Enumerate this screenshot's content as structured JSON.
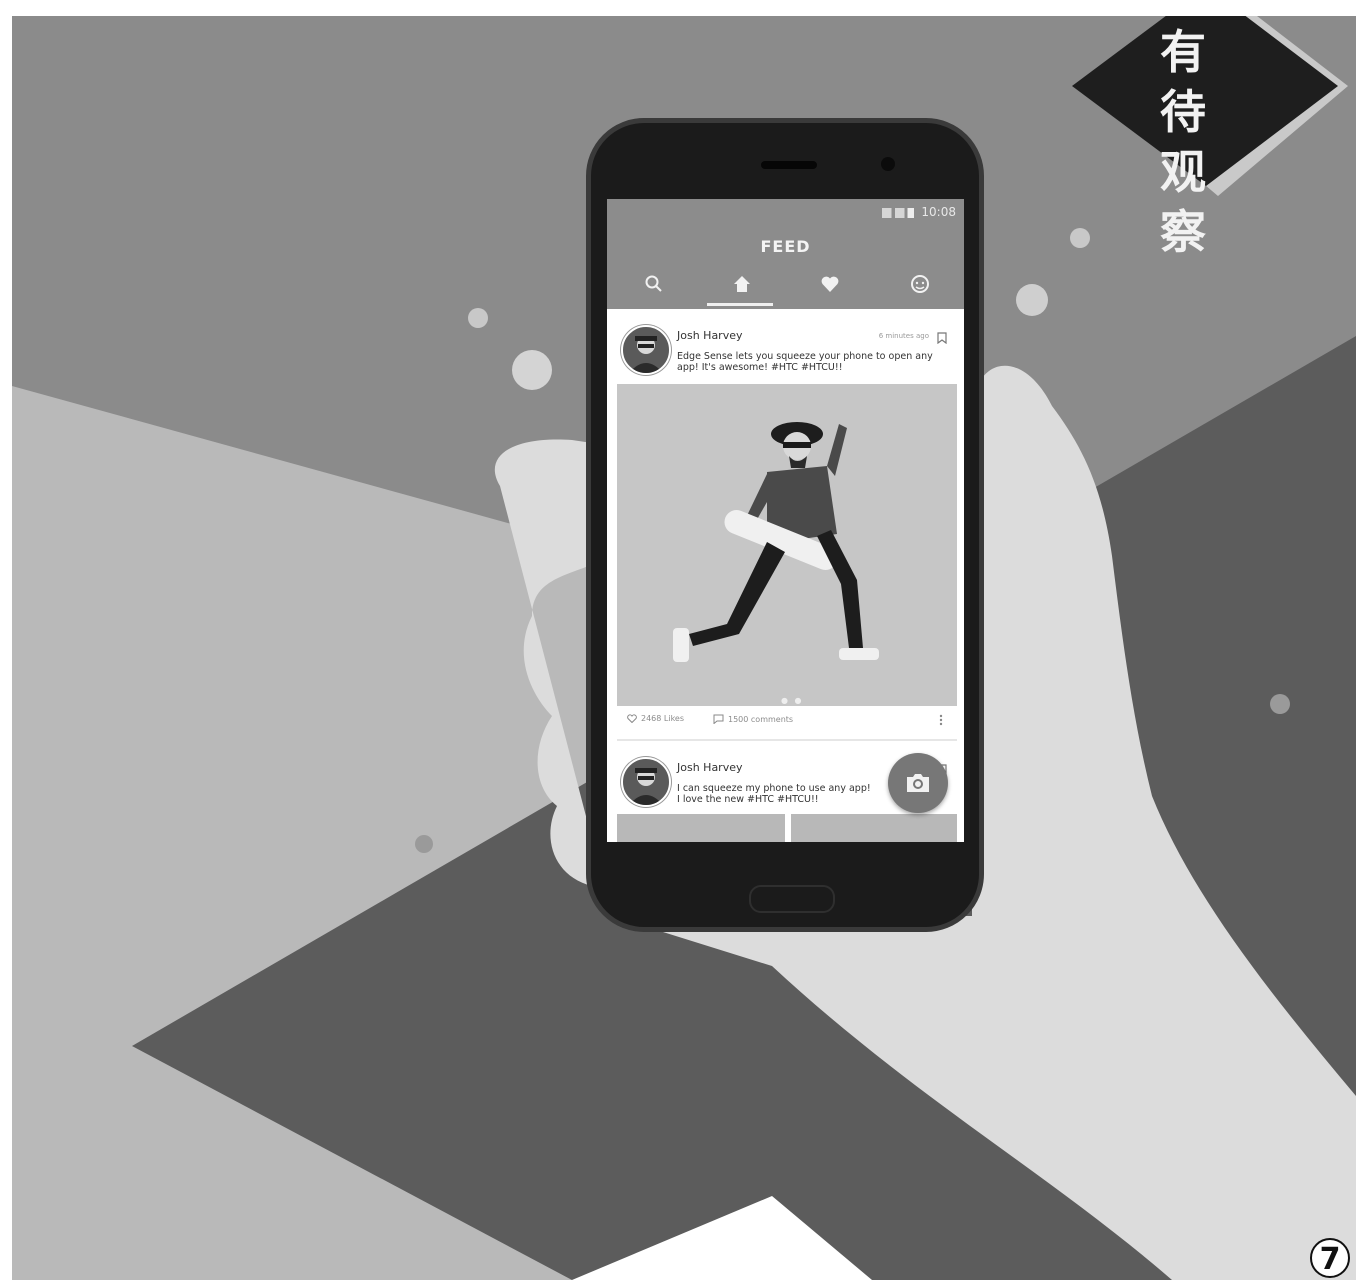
{
  "badge": {
    "line1": "有 待",
    "line2": "观 察"
  },
  "page_number": "7",
  "status_bar": {
    "time": "10:08"
  },
  "app": {
    "title": "FEED",
    "tabs": [
      {
        "icon": "search-icon"
      },
      {
        "icon": "home-icon",
        "active": true
      },
      {
        "icon": "heart-icon"
      },
      {
        "icon": "profile-icon"
      }
    ]
  },
  "posts": [
    {
      "author": "Josh Harvey",
      "time": "6 minutes ago",
      "text": "Edge Sense lets you squeeze your phone to open any app! It's awesome! #HTC #HTCU!!",
      "likes": "2468 Likes",
      "comments": "1500 comments"
    },
    {
      "author": "Josh Harvey",
      "text_line1": "I can squeeze my phone to use any app!",
      "text_line2": "I love the new #HTC #HTCU!!"
    }
  ],
  "colors": {
    "scene_bg": "#8b8b8b",
    "appbar": "#8c8c8c",
    "badge": "#1e1e1e"
  }
}
